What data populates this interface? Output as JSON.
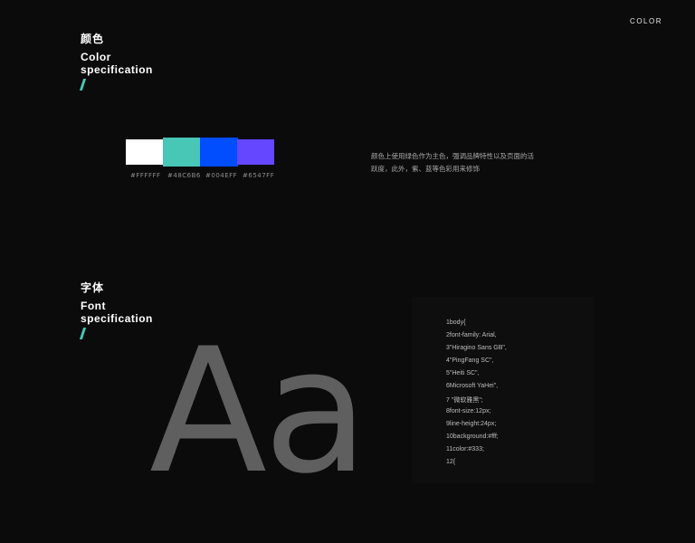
{
  "header": {
    "corner_label": "COLOR"
  },
  "color_section": {
    "title_cn": "颜色",
    "title_en_line1": "Color",
    "title_en_line2": "specification",
    "accent": "#48C6B6",
    "swatches": [
      {
        "color": "#FFFFFF",
        "label": "#FFFFFF"
      },
      {
        "color": "#48C6B6",
        "label": "#48C6B6"
      },
      {
        "color": "#004EFF",
        "label": "#004EFF"
      },
      {
        "color": "#6547FF",
        "label": "#6547FF"
      }
    ],
    "description_line1": "颜色上使用绿色作为主色，强调品牌特性以及页面的活",
    "description_line2": "跃度，此外，紫、蓝等色彩用来修饰"
  },
  "font_section": {
    "title_cn": "字体",
    "title_en_line1": "Font",
    "title_en_line2": "specification",
    "sample": "Aa",
    "code_lines": [
      "1body{",
      "2font-family: Arial,",
      "3\"Hiragino Sans GB\",",
      "4\"PingFang SC\",",
      "5\"Heiti SC\",",
      "6Microsoft YaHei\",",
      "7 \"微软雅黑\";",
      "8font-size:12px;",
      "9line-height:24px;",
      "10background:#fff;",
      "11color:#333;",
      "12{"
    ]
  }
}
